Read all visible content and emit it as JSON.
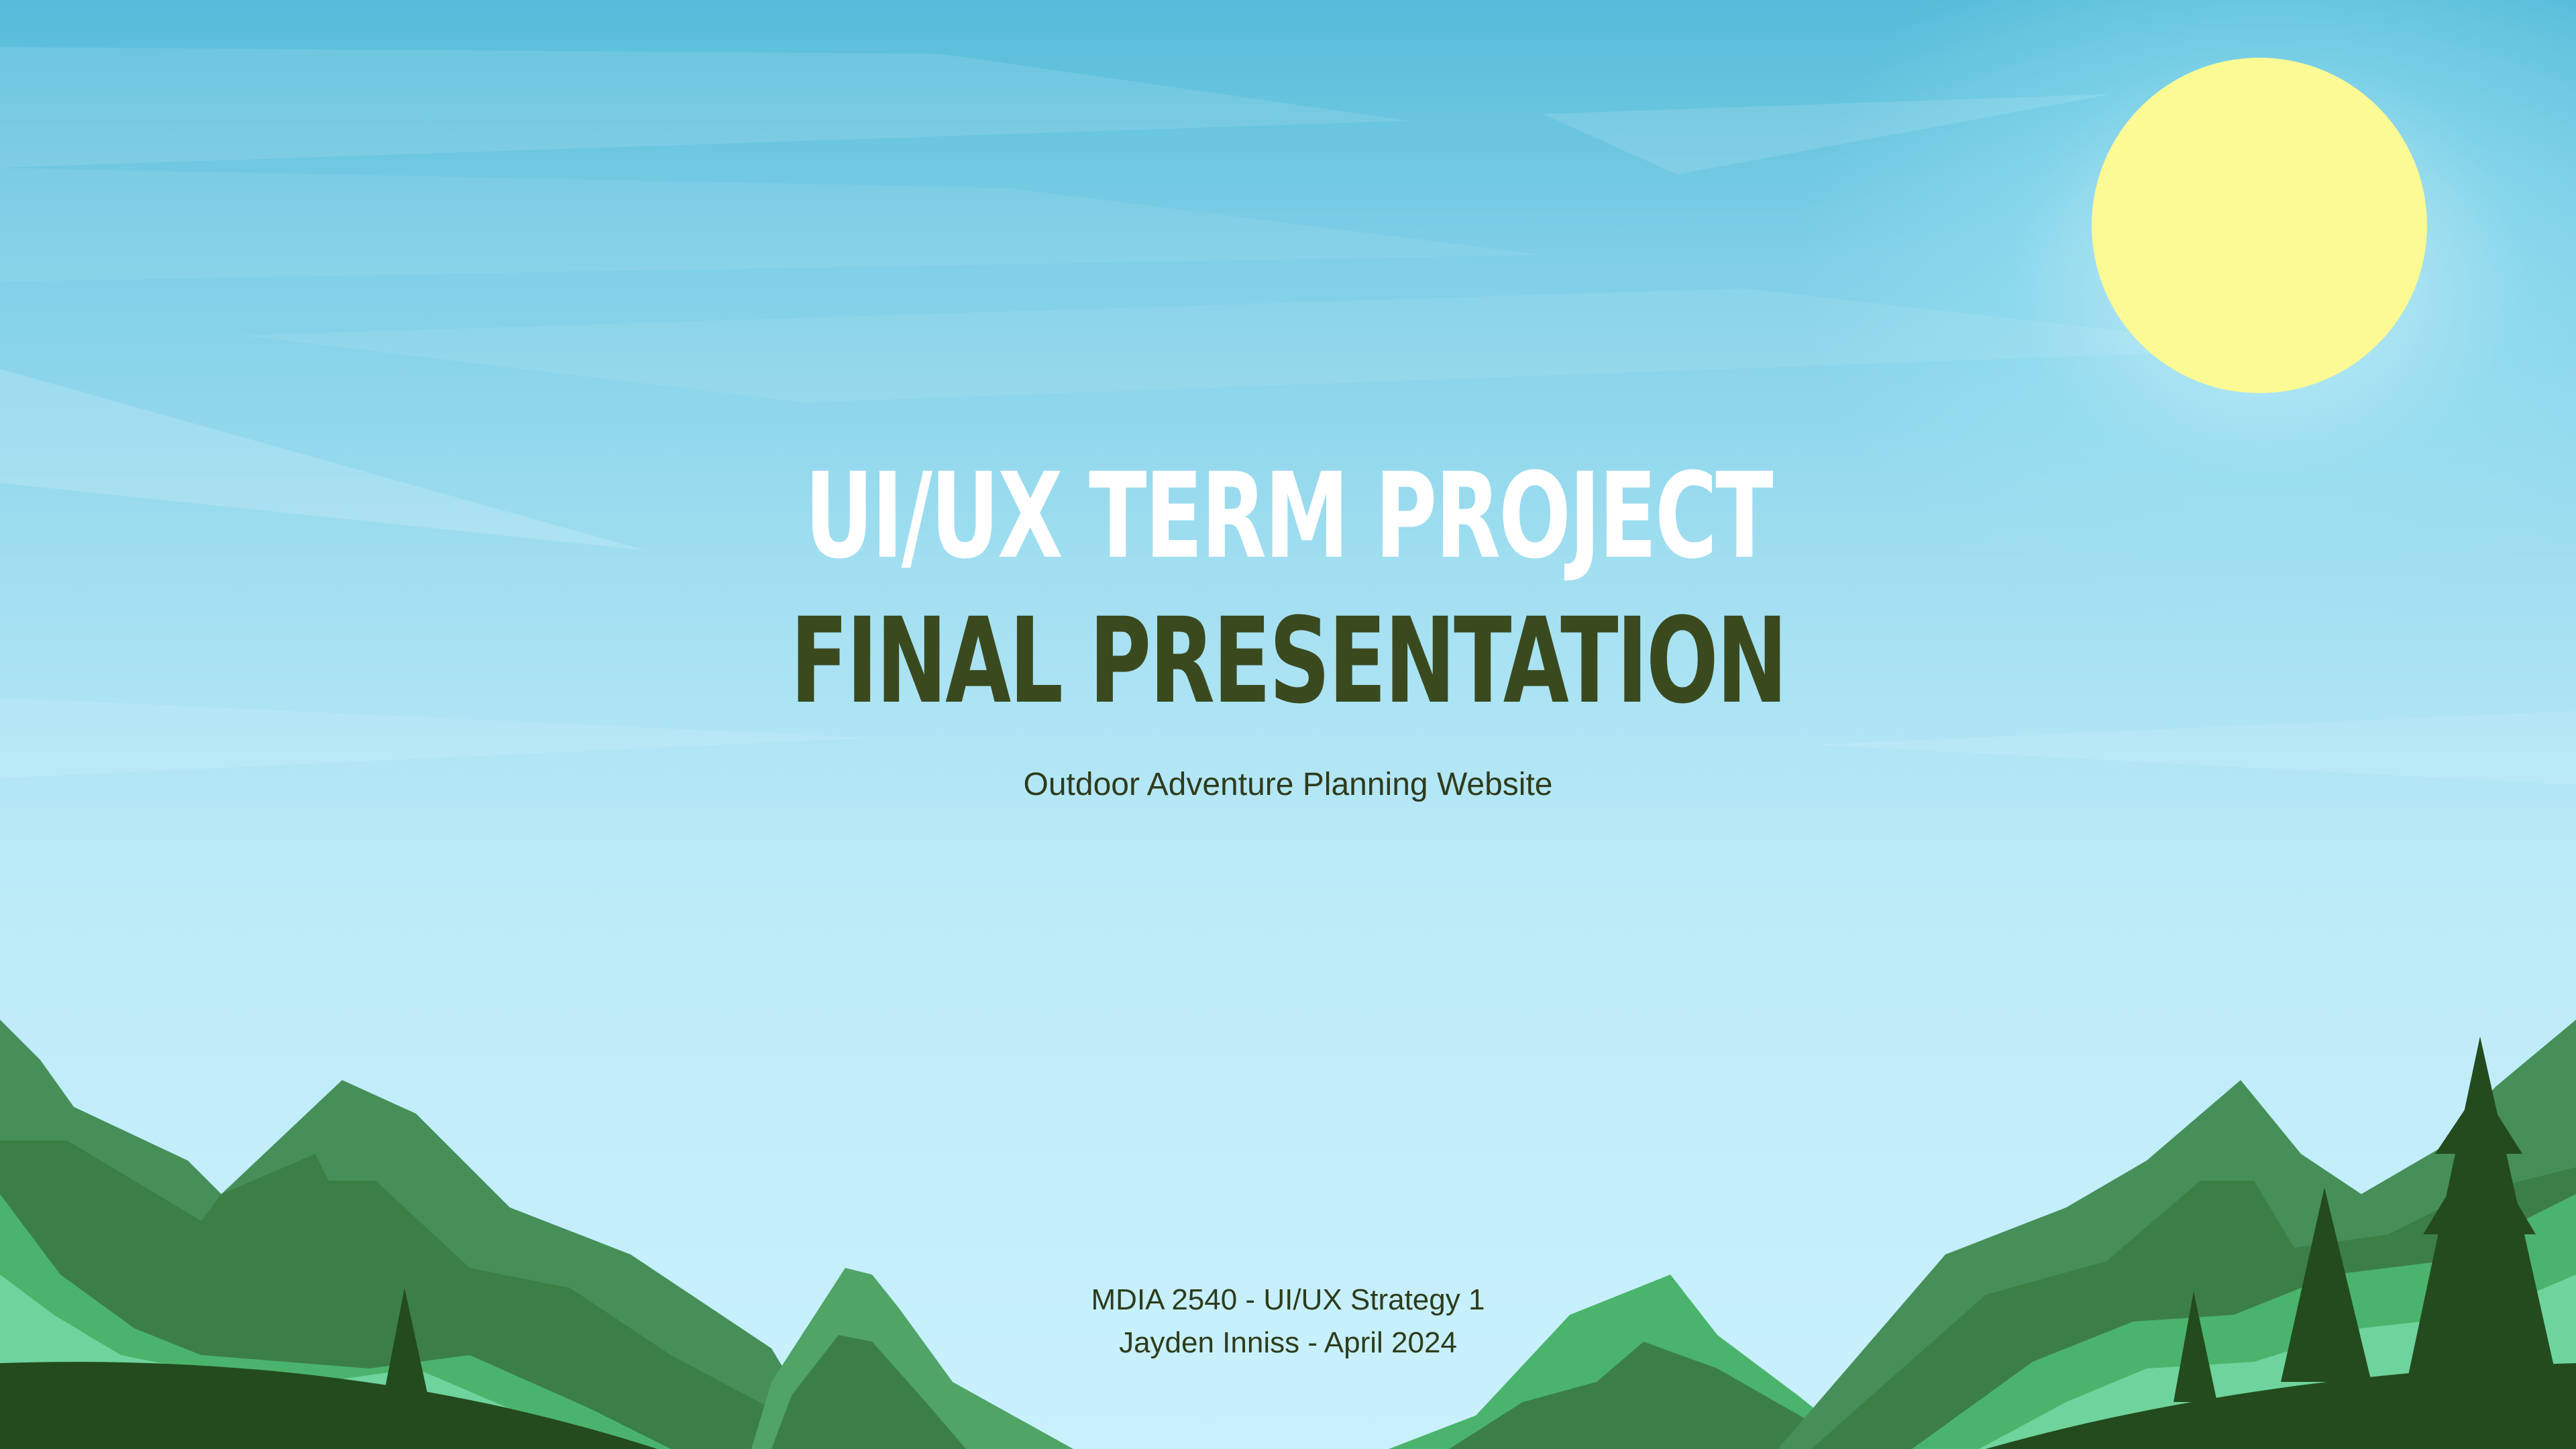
{
  "slide": {
    "title_line1": "UI/UX TERM PROJECT",
    "title_line2": "FINAL PRESENTATION",
    "subtitle": "Outdoor Adventure Planning Website",
    "course_line": "MDIA 2540 - UI/UX Strategy 1",
    "author_line": "Jayden Inniss - April 2024"
  },
  "colors": {
    "sky_top": "#56bcd9",
    "sky_bottom": "#c9f1fc",
    "sun": "#fcfa94",
    "title_primary": "#ffffff",
    "title_secondary": "#3a4a1e",
    "body_text": "#2e3b1c",
    "mountain_mid": "#468f58",
    "mountain_dark": "#3b7f47",
    "mountain_light": "#4bb46c",
    "mountain_pale": "#6fd39d",
    "forest_dark": "#234b1d"
  }
}
